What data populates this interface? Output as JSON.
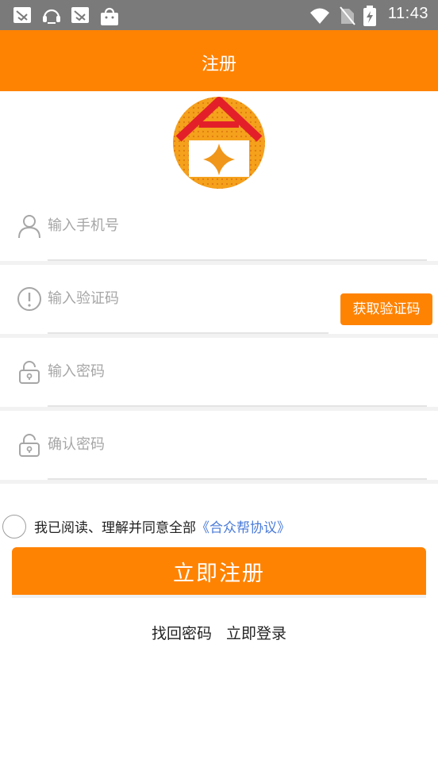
{
  "status_bar": {
    "time": "11:43",
    "left_icons": [
      "notification-icon",
      "assistant-icon",
      "notification-icon",
      "shopping-bag-icon"
    ],
    "right_icons": [
      "wifi-icon",
      "no-sim-icon",
      "battery-charging-icon"
    ]
  },
  "header": {
    "title": "注册"
  },
  "form": {
    "phone": {
      "placeholder": "输入手机号",
      "icon": "user-icon"
    },
    "code": {
      "placeholder": "输入验证码",
      "icon": "alert-circle-icon",
      "button_label": "获取验证码"
    },
    "password": {
      "placeholder": "输入密码",
      "icon": "lock-icon"
    },
    "confirm": {
      "placeholder": "确认密码",
      "icon": "lock-icon"
    }
  },
  "agreement": {
    "prefix": "我已阅读、理解并同意全部",
    "link": "《合众帮协议》"
  },
  "register_button": "立即注册",
  "footer": {
    "forgot_password": "找回密码",
    "login_now": "立即登录"
  },
  "colors": {
    "accent": "#ff8303",
    "link": "#4a7bd9",
    "status_bar": "#7a7a7a"
  }
}
